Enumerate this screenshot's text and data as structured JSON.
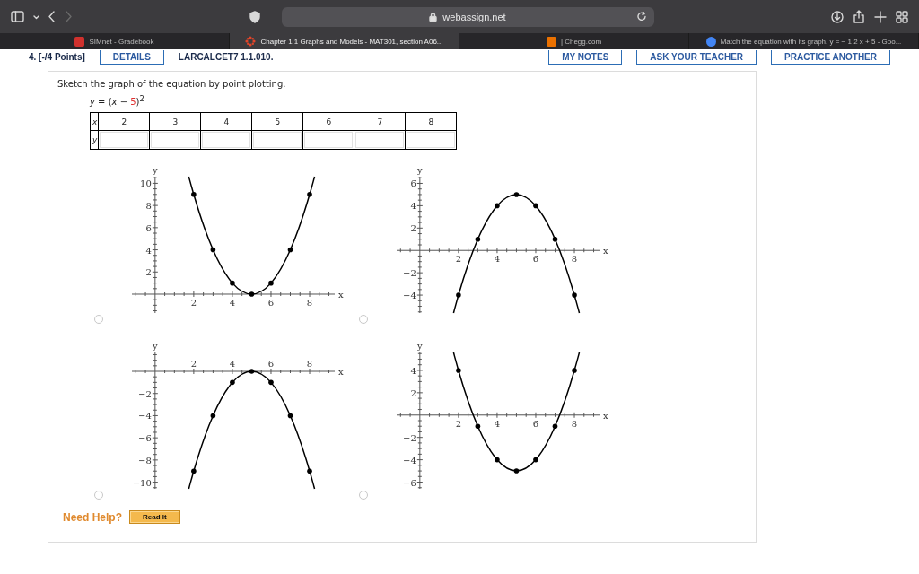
{
  "toolbar": {
    "address": "webassign.net",
    "forward_disabled": true
  },
  "tabs": [
    {
      "label": "SIMnet - Gradebook",
      "selected": false,
      "kind": "square",
      "color": "#d0312d"
    },
    {
      "label": "Chapter 1.1 Graphs and Models - MAT301, section A06...",
      "selected": true,
      "kind": "star",
      "color": "#e0452a"
    },
    {
      "label": "| Chegg.com",
      "selected": false,
      "kind": "square",
      "color": "#eb7100"
    },
    {
      "label": "Match the equation with its graph. y = − 1 2 x + 5 - Goo...",
      "selected": false,
      "kind": "circle",
      "color": "#4285f4"
    }
  ],
  "question_header": {
    "points": "4.  [-/4 Points]",
    "details": "DETAILS",
    "code": "LARCALCET7 1.1.010.",
    "actions": [
      "MY NOTES",
      "ASK YOUR TEACHER",
      "PRACTICE ANOTHER"
    ]
  },
  "question": {
    "prompt": "Sketch the graph of the equation by point plotting.",
    "equation": {
      "before": "*y* = (*x* − ",
      "highlight": "5",
      "after": ")$^{2}$"
    },
    "table": {
      "x_label": "x",
      "y_label": "y",
      "x_values": [
        "2",
        "3",
        "4",
        "5",
        "6",
        "7",
        "8"
      ]
    },
    "choices": [
      {
        "selected": false,
        "chart_data": {
          "type": "line",
          "xlabel": "x",
          "ylabel": "y",
          "x": [
            2,
            3,
            4,
            5,
            6,
            7,
            8
          ],
          "series": [
            {
              "values": [
                9,
                4,
                1,
                0,
                1,
                4,
                9
              ]
            }
          ],
          "xlim": [
            -1.2,
            9.3
          ],
          "ylim": [
            -1.7,
            10.6
          ],
          "xticks": [
            2,
            4,
            6,
            8
          ],
          "yticks": [
            2,
            4,
            6,
            8,
            10
          ]
        }
      },
      {
        "selected": false,
        "chart_data": {
          "type": "line",
          "xlabel": "x",
          "ylabel": "y",
          "x": [
            2,
            3,
            4,
            5,
            6,
            7,
            8
          ],
          "series": [
            {
              "values": [
                -4,
                1,
                4,
                5,
                4,
                1,
                -4
              ]
            }
          ],
          "xlim": [
            -1.2,
            9.3
          ],
          "ylim": [
            -5.6,
            6.6
          ],
          "xticks": [
            2,
            4,
            6,
            8
          ],
          "yticks": [
            -4,
            -2,
            2,
            4,
            6
          ]
        }
      },
      {
        "selected": false,
        "chart_data": {
          "type": "line",
          "xlabel": "x",
          "ylabel": "y",
          "x": [
            2,
            3,
            4,
            5,
            6,
            7,
            8
          ],
          "series": [
            {
              "values": [
                -9,
                -4,
                -1,
                0,
                -1,
                -4,
                -9
              ]
            }
          ],
          "xlim": [
            -1.2,
            9.3
          ],
          "ylim": [
            -10.6,
            1.7
          ],
          "xticks": [
            2,
            4,
            6,
            8
          ],
          "yticks": [
            -10,
            -8,
            -6,
            -4,
            -2
          ]
        }
      },
      {
        "selected": false,
        "chart_data": {
          "type": "line",
          "xlabel": "x",
          "ylabel": "y",
          "x": [
            2,
            3,
            4,
            5,
            6,
            7,
            8
          ],
          "series": [
            {
              "values": [
                4,
                -1,
                -4,
                -5,
                -4,
                -1,
                4
              ]
            }
          ],
          "xlim": [
            -1.2,
            9.3
          ],
          "ylim": [
            -6.6,
            5.6
          ],
          "xticks": [
            2,
            4,
            6,
            8
          ],
          "yticks": [
            -6,
            -4,
            -2,
            2,
            4
          ]
        }
      }
    ],
    "help": {
      "label": "Need Help?",
      "button": "Read It"
    }
  }
}
